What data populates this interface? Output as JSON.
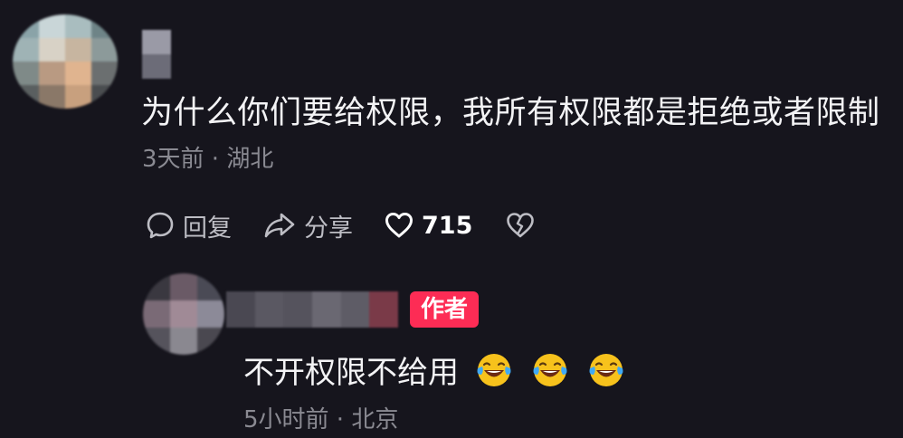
{
  "comment": {
    "text": "为什么你们要给权限，我所有权限都是拒绝或者限制",
    "meta": "3天前 · 湖北",
    "actions": {
      "reply_label": "回复",
      "share_label": "分享",
      "like_count": "715"
    }
  },
  "reply": {
    "badge": "作者",
    "text": "不开权限不给用",
    "emojis": [
      "laughing-crying-emoji",
      "laughing-crying-emoji",
      "laughing-crying-emoji"
    ],
    "meta": "5小时前 · 北京"
  },
  "colors": {
    "background": "#16151d",
    "text_primary": "#f3f3f5",
    "text_secondary": "#8a8a92",
    "badge": "#fd2c55"
  }
}
